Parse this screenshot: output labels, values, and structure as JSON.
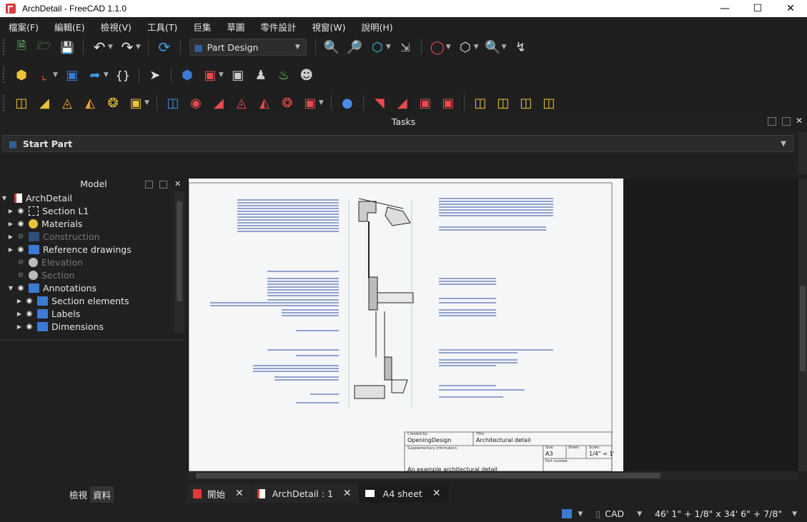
{
  "window": {
    "title": "ArchDetail - FreeCAD 1.1.0"
  },
  "menu": [
    "檔案(F)",
    "編輯(E)",
    "檢視(V)",
    "工具(T)",
    "巨集",
    "草圖",
    "零件設計",
    "視窗(W)",
    "說明(H)"
  ],
  "toolbar": {
    "workbench": "Part Design"
  },
  "tasks": {
    "header": "Tasks",
    "start_part": "Start Part"
  },
  "model": {
    "header": "Model",
    "items": [
      {
        "label": "ArchDetail",
        "level": 0,
        "dim": false
      },
      {
        "label": "Section L1",
        "level": 1,
        "dim": false
      },
      {
        "label": "Materials",
        "level": 1,
        "dim": false
      },
      {
        "label": "Construction",
        "level": 1,
        "dim": true
      },
      {
        "label": "Reference drawings",
        "level": 1,
        "dim": false
      },
      {
        "label": "Elevation",
        "level": 1,
        "dim": true
      },
      {
        "label": "Section",
        "level": 1,
        "dim": true
      },
      {
        "label": "Annotations",
        "level": 1,
        "dim": false
      },
      {
        "label": "Section elements",
        "level": 2,
        "dim": false
      },
      {
        "label": "Labels",
        "level": 2,
        "dim": false
      },
      {
        "label": "Dimensions",
        "level": 2,
        "dim": false
      }
    ]
  },
  "left_tabs": [
    "檢視",
    "資料"
  ],
  "drawing": {
    "created_by_label": "Created by:",
    "created_by": "OpeningDesign",
    "title_label": "Title:",
    "title": "Architectural detail",
    "supplementary_label": "Supplementary information:",
    "supplementary": "An example architectural detail",
    "size_label": "Size:",
    "size": "A3",
    "sheet_label": "Sheet:",
    "scale_label": "Scale:",
    "scale": "1/4\" = 1'",
    "part_number_label": "Part number:"
  },
  "tabs": [
    "開始",
    "ArchDetail : 1",
    "A4 sheet"
  ],
  "status": {
    "nav": "CAD",
    "dimensions": "46' 1\" + 1/8\" x 34' 6\" + 7/8\""
  },
  "colors": {
    "accent": "#3b7bd6",
    "brand": "#e03a3a",
    "annotation": "#2b4fa8"
  }
}
